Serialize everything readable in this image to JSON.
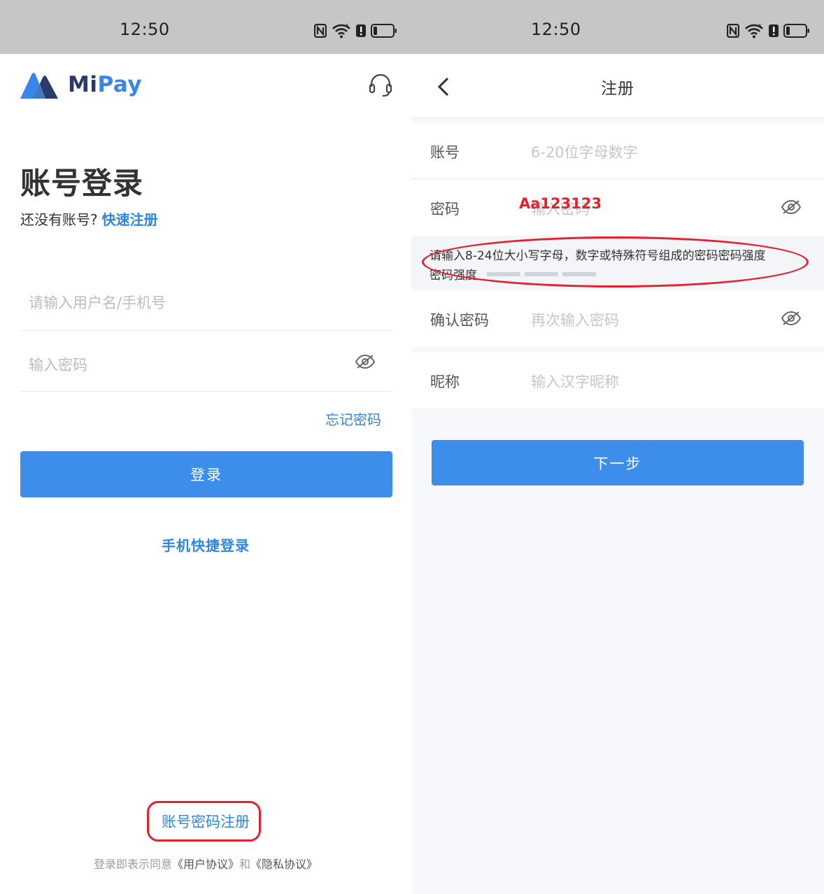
{
  "status_bar": {
    "time": "12:50"
  },
  "login": {
    "logo": {
      "mi": "Mi",
      "pay": "Pay"
    },
    "title": "账号登录",
    "no_account_text": "还没有账号?",
    "quick_register": "快速注册",
    "username_placeholder": "请输入用户名/手机号",
    "password_placeholder": "输入密码",
    "forgot_password": "忘记密码",
    "login_button": "登录",
    "phone_login": "手机快捷登录",
    "account_register": "账号密码注册",
    "agreement": {
      "prefix": "登录即表示同意",
      "user_agreement": "《用户协议》",
      "and": "和",
      "privacy_policy": "《隐私协议》"
    }
  },
  "register": {
    "title": "注册",
    "account": {
      "label": "账号",
      "placeholder": "6-20位字母数字"
    },
    "password": {
      "label": "密码",
      "placeholder": "输入密码",
      "annotated_value": "Aa123123"
    },
    "hint": "请输入8-24位大小写字母，数字或特殊符号组成的密码密码强度",
    "strength_label": "密码强度",
    "strength_level": 0,
    "strength_segments": 3,
    "confirm": {
      "label": "确认密码",
      "placeholder": "再次输入密码"
    },
    "nickname": {
      "label": "昵称",
      "placeholder": "输入汉字昵称"
    },
    "next_button": "下一步"
  },
  "colors": {
    "primary": "#3d8eeb",
    "link": "#2f86e0",
    "annotation": "#e3222e",
    "status_bar": "#c6c6c6"
  }
}
